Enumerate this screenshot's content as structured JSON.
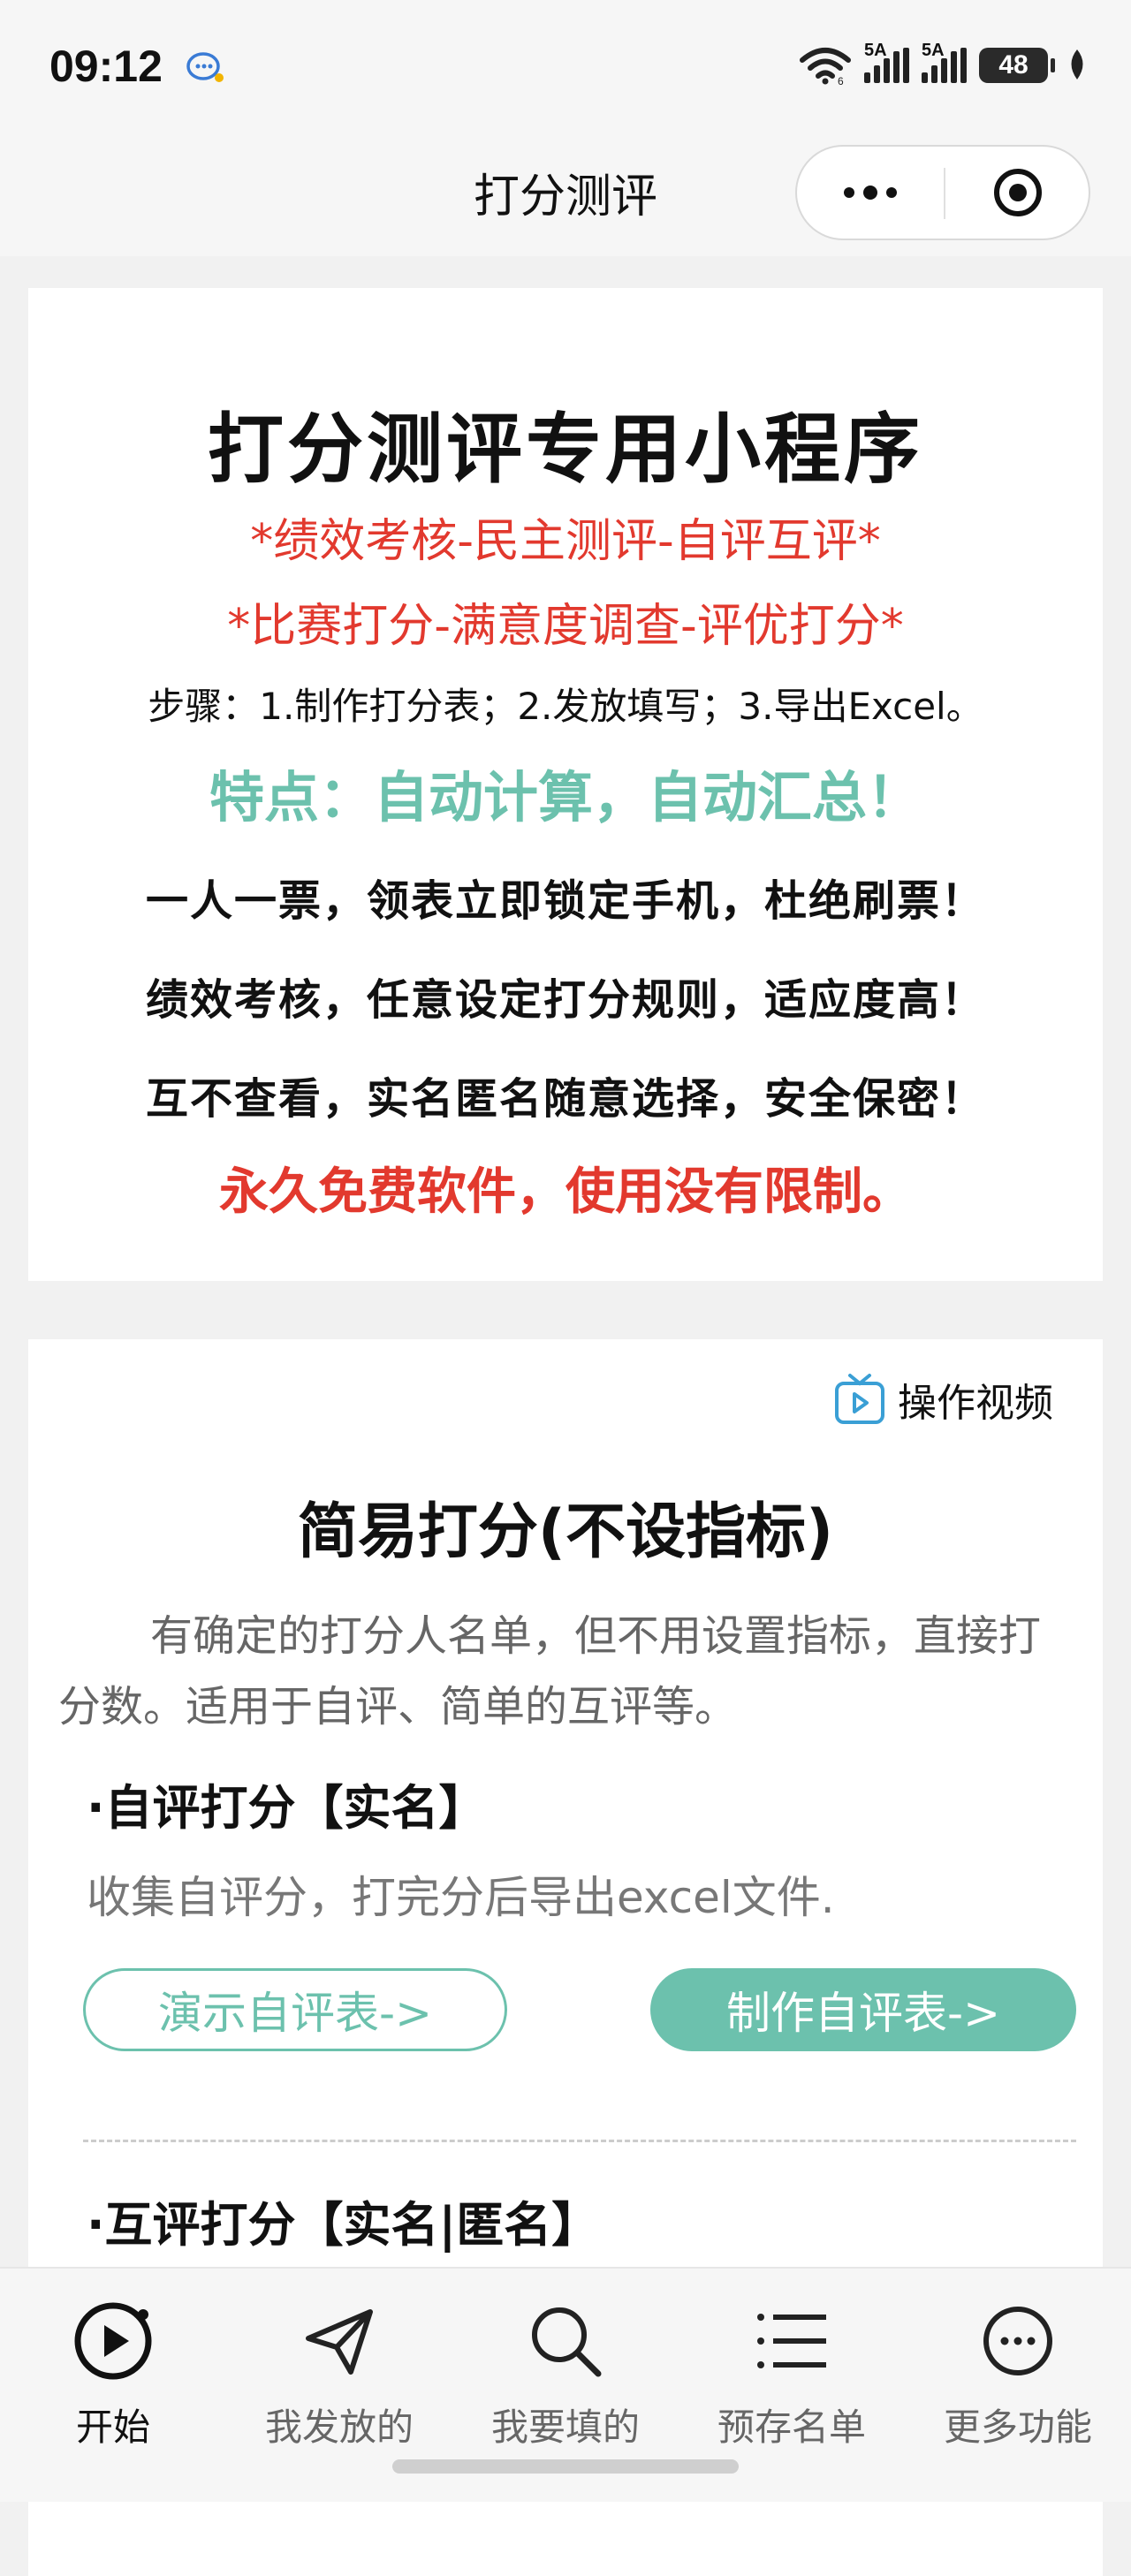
{
  "status_bar": {
    "time": "09:12",
    "signal1_label": "5A",
    "signal2_label": "5A",
    "battery": "48",
    "icons": [
      "message-app-icon",
      "wifi-icon",
      "signal-icon",
      "signal-icon",
      "battery-icon",
      "leaf-icon"
    ]
  },
  "nav": {
    "title": "打分测评",
    "icons": [
      "more-dots-icon",
      "close-target-icon"
    ]
  },
  "intro_card": {
    "title": "打分测评专用小程序",
    "red_line_1": "*绩效考核-民主测评-自评互评*",
    "red_line_2": "*比赛打分-满意度调查-评优打分*",
    "steps": "步骤：1.制作打分表；2.发放填写；3.导出Excel。",
    "feature": "特点：自动计算，自动汇总！",
    "bullet_1": "一人一票，领表立即锁定手机，杜绝刷票！",
    "bullet_2": "绩效考核，任意设定打分规则，适应度高！",
    "bullet_3": "互不查看，实名匿名随意选择，安全保密！",
    "free_note": "永久免费软件，使用没有限制。"
  },
  "simple_card": {
    "video_label": "操作视频",
    "title": "简易打分(不设指标)",
    "description": "有确定的打分人名单，但不用设置指标，直接打分数。适用于自评、简单的互评等。",
    "self_section": {
      "heading": "·自评打分【实名】",
      "description": "收集自评分，打完分后导出excel文件.",
      "demo_button": "演示自评表->",
      "make_button": "制作自评表->"
    },
    "peer_section": {
      "heading": "·互评打分【实名|匿名】"
    }
  },
  "tab_bar": {
    "tabs": [
      {
        "label": "开始",
        "icon": "play-circle-icon",
        "active": true
      },
      {
        "label": "我发放的",
        "icon": "send-icon",
        "active": false
      },
      {
        "label": "我要填的",
        "icon": "search-icon",
        "active": false
      },
      {
        "label": "预存名单",
        "icon": "list-icon",
        "active": false
      },
      {
        "label": "更多功能",
        "icon": "more-circle-icon",
        "active": false
      }
    ]
  },
  "colors": {
    "accent_green": "#6cc1ad",
    "accent_red": "#e2392e",
    "background": "#f1f1f1"
  }
}
